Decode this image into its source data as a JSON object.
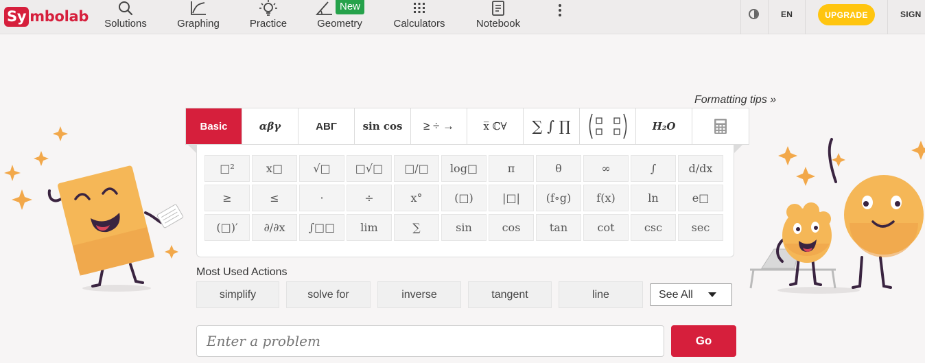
{
  "brand": {
    "logo_highlight": "Sy",
    "logo_rest": "mbolab",
    "color": "#d61f3c"
  },
  "nav": {
    "items": [
      {
        "label": "Solutions",
        "icon": "search-icon"
      },
      {
        "label": "Graphing",
        "icon": "graph-icon"
      },
      {
        "label": "Practice",
        "icon": "lightbulb-icon"
      },
      {
        "label": "Geometry",
        "icon": "angle-icon",
        "badge": "New"
      },
      {
        "label": "Calculators",
        "icon": "calculator-grid-icon"
      },
      {
        "label": "Notebook",
        "icon": "notebook-icon"
      }
    ],
    "more_icon": "kebab-menu-icon"
  },
  "header_right": {
    "theme_icon": "contrast-icon",
    "language": "EN",
    "upgrade_label": "UPGRADE",
    "upgrade_color": "#ffc50f",
    "sign_label": "SIGN"
  },
  "keyboard": {
    "formatting_tips": "Formatting tips »",
    "tabs": [
      {
        "label": "Basic",
        "active": true
      },
      {
        "label": "αβγ"
      },
      {
        "label": "ΑΒΓ"
      },
      {
        "label": "sin cos"
      },
      {
        "label": "≥ ÷ →"
      },
      {
        "label": "x̅ ℂ∀"
      },
      {
        "label": "∑ ∫ ∏"
      },
      {
        "label": "matrix"
      },
      {
        "label": "H₂O"
      },
      {
        "label": "calculator",
        "icon": "calculator-icon"
      }
    ],
    "keys": [
      "□²",
      "x□",
      "√□",
      "□√□",
      "□/□",
      "log□",
      "π",
      "θ",
      "∞",
      "∫",
      "d/dx",
      "≥",
      "≤",
      "·",
      "÷",
      "x°",
      "(□)",
      "|□|",
      "(f∘g)",
      "f(x)",
      "ln",
      "e□",
      "(□)′",
      "∂/∂x",
      "∫□□",
      "lim",
      "∑",
      "sin",
      "cos",
      "tan",
      "cot",
      "csc",
      "sec"
    ]
  },
  "most_used": {
    "title": "Most Used Actions",
    "actions": [
      "simplify",
      "solve for",
      "inverse",
      "tangent",
      "line"
    ],
    "see_all": "See All"
  },
  "problem": {
    "placeholder": "Enter a problem",
    "value": "",
    "go_label": "Go"
  }
}
